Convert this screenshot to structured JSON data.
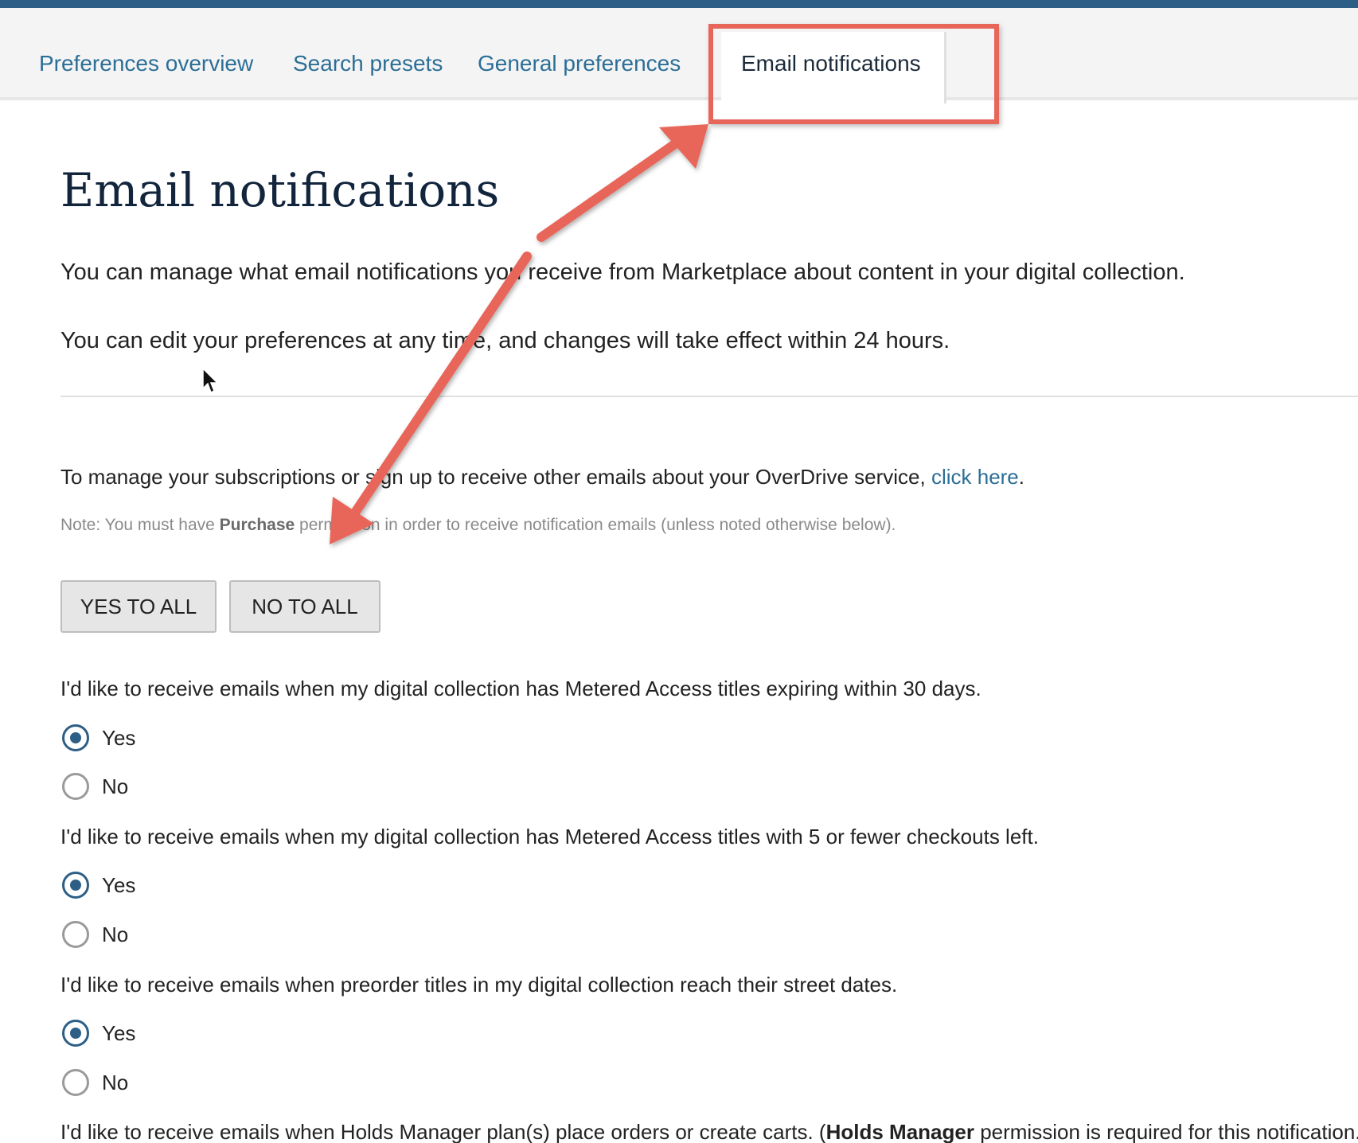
{
  "tabs": [
    {
      "label": "Preferences overview",
      "active": false
    },
    {
      "label": "Search presets",
      "active": false
    },
    {
      "label": "General preferences",
      "active": false
    },
    {
      "label": "Email notifications",
      "active": true
    }
  ],
  "page": {
    "title": "Email notifications",
    "intro_1": "You can manage what email notifications you receive from Marketplace about content in your digital collection.",
    "intro_2": "You can edit your preferences at any time, and changes will take effect within 24 hours.",
    "subscriptions_text": "To manage your subscriptions or sign up to receive other emails about your OverDrive service, ",
    "subscriptions_link": "click here",
    "subscriptions_end": ".",
    "note_prefix": "Note: You must have ",
    "note_bold": "Purchase",
    "note_suffix": " permission in order to receive notification emails (unless noted otherwise below)."
  },
  "buttons": {
    "yes_all": "YES TO ALL",
    "no_all": "NO TO ALL"
  },
  "questions": [
    {
      "text": "I'd like to receive emails when my digital collection has Metered Access titles expiring within 30 days.",
      "yes": "Yes",
      "no": "No",
      "selected": "yes"
    },
    {
      "text": "I'd like to receive emails when my digital collection has Metered Access titles with 5 or fewer checkouts left.",
      "yes": "Yes",
      "no": "No",
      "selected": "yes"
    },
    {
      "text": "I'd like to receive emails when preorder titles in my digital collection reach their street dates.",
      "yes": "Yes",
      "no": "No",
      "selected": "yes"
    },
    {
      "text_prefix": "I'd like to receive emails when Holds Manager plan(s) place orders or create carts. (",
      "text_bold": "Holds Manager",
      "text_suffix": " permission is required for this notification.)"
    }
  ],
  "colors": {
    "accent": "#2d5f86",
    "link": "#2c6e96",
    "annotation": "#e8655a"
  }
}
